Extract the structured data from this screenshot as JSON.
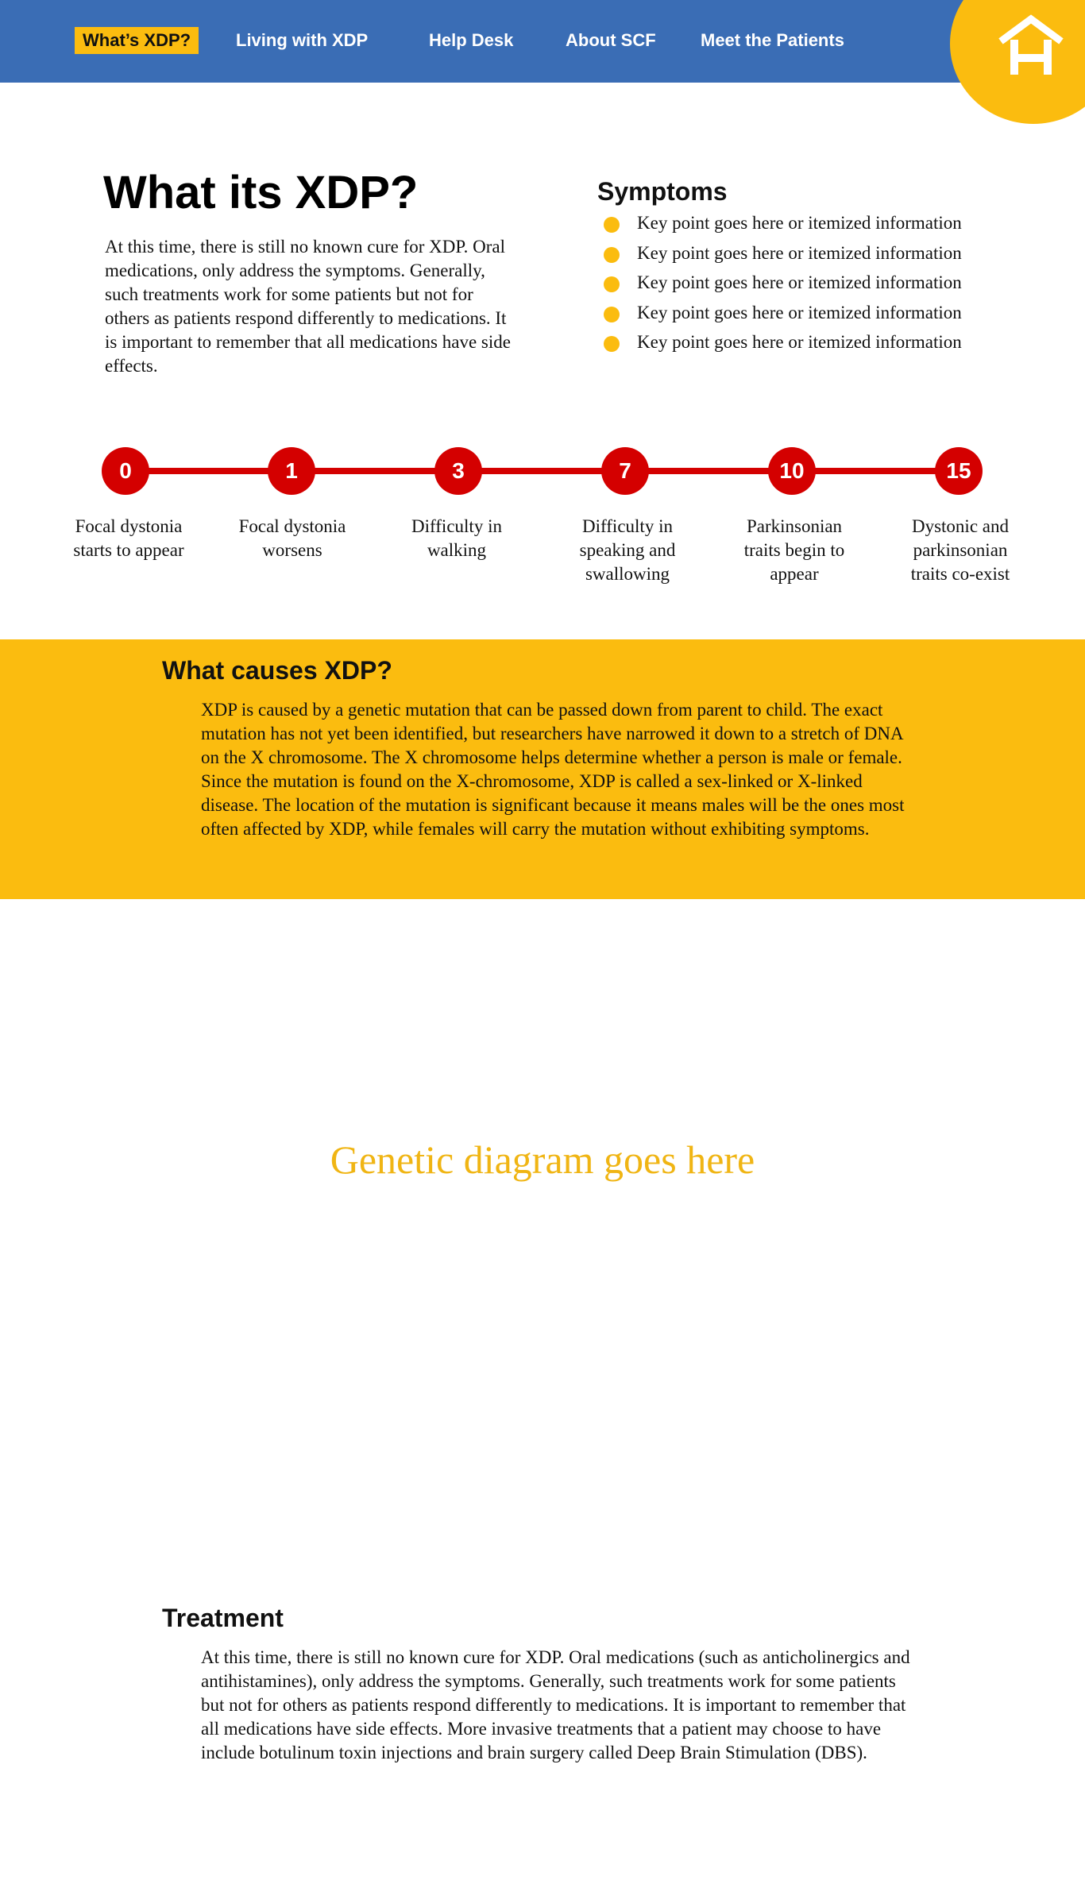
{
  "colors": {
    "nav_bg": "#3a6db5",
    "accent_yellow": "#fbbc0f",
    "timeline_red": "#d40000",
    "placeholder_text": "#f0b514"
  },
  "nav": {
    "items": [
      {
        "label": "What’s XDP?",
        "active": true
      },
      {
        "label": "Living with XDP",
        "active": false
      },
      {
        "label": "Help Desk",
        "active": false
      },
      {
        "label": "About SCF",
        "active": false
      },
      {
        "label": "Meet the Patients",
        "active": false
      }
    ],
    "home_icon": "home-icon"
  },
  "intro": {
    "title": "What its XDP?",
    "text": "At this time, there is still no known cure for XDP. Oral medications, only address the symptoms. Generally, such treatments work for some patients but not for others as patients respond differently to medications. It is important to remember that all medications have side effects."
  },
  "symptoms": {
    "title": "Symptoms",
    "items": [
      "Key point goes here or itemized information",
      "Key point goes here or itemized information",
      "Key point goes here or itemized information",
      "Key point goes here or itemized information",
      "Key point goes here or itemized information"
    ]
  },
  "timeline": {
    "nodes": [
      {
        "value": "0",
        "label": "Focal dystonia starts to appear"
      },
      {
        "value": "1",
        "label": "Focal dystonia worsens"
      },
      {
        "value": "3",
        "label": "Difficulty in walking"
      },
      {
        "value": "7",
        "label": "Difficulty in speaking and swallowing"
      },
      {
        "value": "10",
        "label": "Parkinsonian traits begin to appear"
      },
      {
        "value": "15",
        "label": "Dystonic and parkinsonian traits co-exist"
      }
    ]
  },
  "causes": {
    "title": "What causes XDP?",
    "text": "XDP is caused by a genetic mutation that can be passed down from parent to child. The exact mutation has not yet been identified, but researchers have narrowed it down to a stretch of DNA on the X chromosome. The X chromosome helps determine whether a person is male or female. Since the mutation is found on the X-chromosome, XDP is called a sex-linked or X-linked disease. The location of the mutation is significant because it means males will be the ones most often affected by XDP, while females will carry the mutation without exhibiting symptoms."
  },
  "diagram": {
    "placeholder": "Genetic diagram goes here"
  },
  "treatment": {
    "title": "Treatment",
    "text": "At this time, there is still no known cure for XDP. Oral medications (such as anticholinergics and antihistamines), only address the symptoms. Generally, such treatments work for some patients but not for others as patients respond differently to medications. It is important to remember that all medications have side effects. More invasive treatments that a patient may choose to have include botulinum toxin injections and brain surgery called Deep Brain Stimulation (DBS)."
  }
}
